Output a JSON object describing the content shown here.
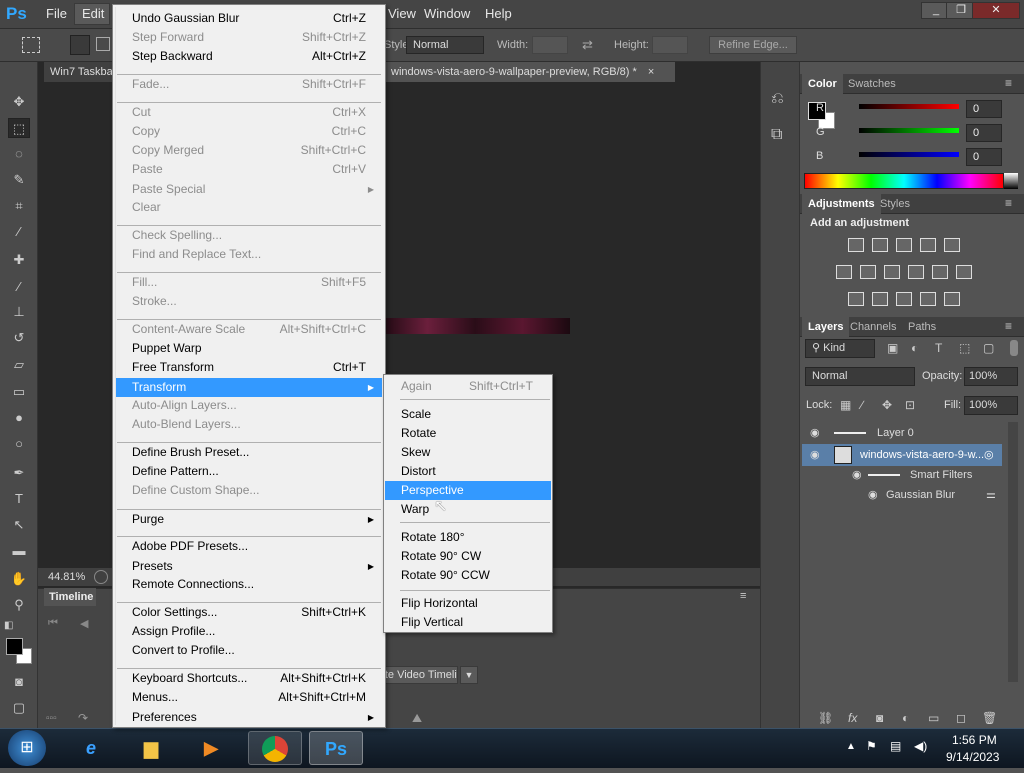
{
  "menubar": {
    "items": [
      "File",
      "Edit",
      "View",
      "Window",
      "Help"
    ],
    "logo": "Ps"
  },
  "window_controls": [
    "_",
    "❐",
    "✕"
  ],
  "options_bar": {
    "style_label": "Style:",
    "style_value": "Normal",
    "width_label": "Width:",
    "height_label": "Height:",
    "refine_edge": "Refine Edge..."
  },
  "doc_tabs": {
    "tab1": "Win7 Taskba",
    "tab2": "windows-vista-aero-9-wallpaper-preview, RGB/8) *",
    "close": "×"
  },
  "status": {
    "zoom": "44.81%"
  },
  "timeline": {
    "tab": "Timeline",
    "button": "Create Video Timeline"
  },
  "color_panel": {
    "tabs": [
      "Color",
      "Swatches"
    ],
    "r_label": "R",
    "g_label": "G",
    "b_label": "B",
    "r": "0",
    "g": "0",
    "b": "0"
  },
  "adjustments": {
    "tabs": [
      "Adjustments",
      "Styles"
    ],
    "heading": "Add an adjustment"
  },
  "layers": {
    "tabs": [
      "Layers",
      "Channels",
      "Paths"
    ],
    "filter_kind": "Kind",
    "blend": "Normal",
    "opacity_label": "Opacity:",
    "opacity": "100%",
    "lock_label": "Lock:",
    "fill_label": "Fill:",
    "fill": "100%",
    "rows": [
      "Layer 0",
      "windows-vista-aero-9-w...",
      "Smart Filters",
      "Gaussian Blur"
    ]
  },
  "edit_menu": {
    "items": [
      {
        "label": "Undo Gaussian Blur",
        "shortcut": "Ctrl+Z",
        "disabled": false
      },
      {
        "label": "Step Forward",
        "shortcut": "Shift+Ctrl+Z",
        "disabled": true
      },
      {
        "label": "Step Backward",
        "shortcut": "Alt+Ctrl+Z",
        "disabled": false
      },
      {
        "label": "Fade...",
        "shortcut": "Shift+Ctrl+F",
        "disabled": true
      },
      {
        "label": "Cut",
        "shortcut": "Ctrl+X",
        "disabled": true
      },
      {
        "label": "Copy",
        "shortcut": "Ctrl+C",
        "disabled": true
      },
      {
        "label": "Copy Merged",
        "shortcut": "Shift+Ctrl+C",
        "disabled": true
      },
      {
        "label": "Paste",
        "shortcut": "Ctrl+V",
        "disabled": true
      },
      {
        "label": "Paste Special",
        "shortcut": "",
        "disabled": true,
        "submenu": true
      },
      {
        "label": "Clear",
        "shortcut": "",
        "disabled": true
      },
      {
        "label": "Check Spelling...",
        "shortcut": "",
        "disabled": true
      },
      {
        "label": "Find and Replace Text...",
        "shortcut": "",
        "disabled": true
      },
      {
        "label": "Fill...",
        "shortcut": "Shift+F5",
        "disabled": true
      },
      {
        "label": "Stroke...",
        "shortcut": "",
        "disabled": true
      },
      {
        "label": "Content-Aware Scale",
        "shortcut": "Alt+Shift+Ctrl+C",
        "disabled": true
      },
      {
        "label": "Puppet Warp",
        "shortcut": "",
        "disabled": false
      },
      {
        "label": "Free Transform",
        "shortcut": "Ctrl+T",
        "disabled": false
      },
      {
        "label": "Transform",
        "shortcut": "",
        "disabled": false,
        "submenu": true,
        "highlighted": true
      },
      {
        "label": "Auto-Align Layers...",
        "shortcut": "",
        "disabled": true
      },
      {
        "label": "Auto-Blend Layers...",
        "shortcut": "",
        "disabled": true
      },
      {
        "label": "Define Brush Preset...",
        "shortcut": "",
        "disabled": false
      },
      {
        "label": "Define Pattern...",
        "shortcut": "",
        "disabled": false
      },
      {
        "label": "Define Custom Shape...",
        "shortcut": "",
        "disabled": true
      },
      {
        "label": "Purge",
        "shortcut": "",
        "disabled": false,
        "submenu": true
      },
      {
        "label": "Adobe PDF Presets...",
        "shortcut": "",
        "disabled": false
      },
      {
        "label": "Presets",
        "shortcut": "",
        "disabled": false,
        "submenu": true
      },
      {
        "label": "Remote Connections...",
        "shortcut": "",
        "disabled": false
      },
      {
        "label": "Color Settings...",
        "shortcut": "Shift+Ctrl+K",
        "disabled": false
      },
      {
        "label": "Assign Profile...",
        "shortcut": "",
        "disabled": false
      },
      {
        "label": "Convert to Profile...",
        "shortcut": "",
        "disabled": false
      },
      {
        "label": "Keyboard Shortcuts...",
        "shortcut": "Alt+Shift+Ctrl+K",
        "disabled": false
      },
      {
        "label": "Menus...",
        "shortcut": "Alt+Shift+Ctrl+M",
        "disabled": false
      },
      {
        "label": "Preferences",
        "shortcut": "",
        "disabled": false,
        "submenu": true
      }
    ]
  },
  "transform_menu": {
    "items": [
      {
        "label": "Again",
        "shortcut": "Shift+Ctrl+T",
        "disabled": true
      },
      {
        "label": "Scale",
        "shortcut": "",
        "disabled": false
      },
      {
        "label": "Rotate",
        "shortcut": "",
        "disabled": false
      },
      {
        "label": "Skew",
        "shortcut": "",
        "disabled": false
      },
      {
        "label": "Distort",
        "shortcut": "",
        "disabled": false
      },
      {
        "label": "Perspective",
        "shortcut": "",
        "disabled": false,
        "highlighted": true
      },
      {
        "label": "Warp",
        "shortcut": "",
        "disabled": false
      },
      {
        "label": "Rotate 180°",
        "shortcut": "",
        "disabled": false
      },
      {
        "label": "Rotate 90° CW",
        "shortcut": "",
        "disabled": false
      },
      {
        "label": "Rotate 90° CCW",
        "shortcut": "",
        "disabled": false
      },
      {
        "label": "Flip Horizontal",
        "shortcut": "",
        "disabled": false
      },
      {
        "label": "Flip Vertical",
        "shortcut": "",
        "disabled": false
      }
    ]
  },
  "taskbar": {
    "time": "1:56 PM",
    "date": "9/14/2023",
    "apps": [
      "start",
      "internet-explorer",
      "file-explorer",
      "media-player",
      "chrome",
      "photoshop"
    ]
  }
}
